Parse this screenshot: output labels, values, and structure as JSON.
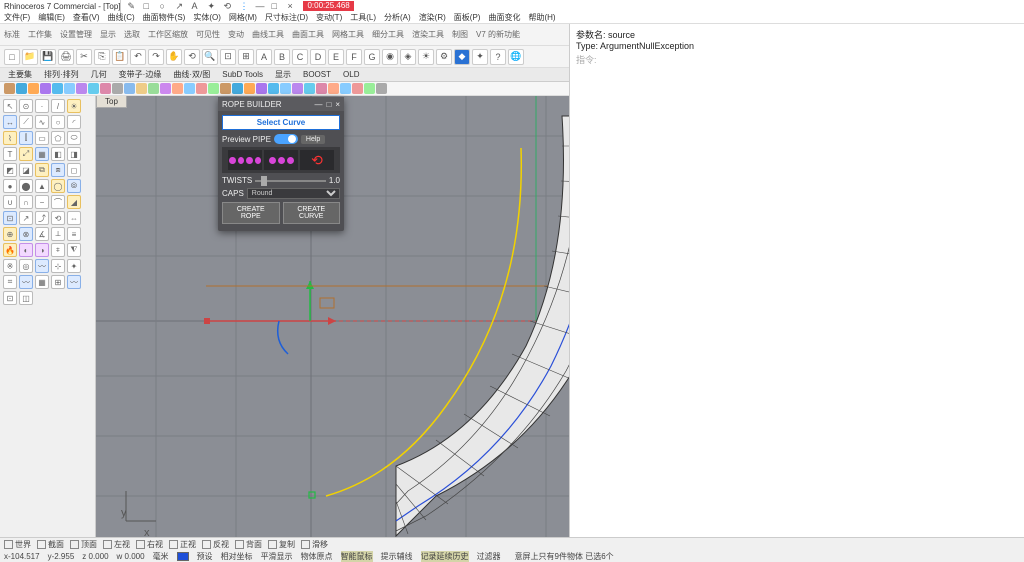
{
  "title": "Rhinoceros 7 Commercial - [Top]",
  "title_badge": "0:00:25.468",
  "menu": [
    "文件(F)",
    "编辑(E)",
    "查看(V)",
    "曲线(C)",
    "曲面物件(S)",
    "实体(O)",
    "网格(M)",
    "尺寸标注(D)",
    "变动(T)",
    "工具(L)",
    "分析(A)",
    "渲染(R)",
    "面板(P)",
    "曲面变化",
    "帮助(H)"
  ],
  "command_panel": {
    "param": "参数名: source",
    "exception": "Type: ArgumentNullException",
    "prompt": "指令:"
  },
  "tabs": [
    "主要集",
    "排列·排列",
    "几何",
    "变带子·边缘",
    "曲线·双/图",
    "SubD Tools",
    "显示",
    "BOOST",
    "OLD"
  ],
  "viewport_tab": "Top",
  "axis_labels": {
    "x": "x",
    "y": "y"
  },
  "panel": {
    "title": "ROPE BUILDER",
    "select_curve": "Select Curve",
    "preview_pipe": "Preview PIPE",
    "help": "Help",
    "twists_label": "TWISTS",
    "twists_value": "1.0",
    "caps_label": "CAPS",
    "caps_value": "Round",
    "create_rope": "CREATE ROPE",
    "create_curve": "CREATE CURVE"
  },
  "status": {
    "row1": [
      "世界",
      "截面",
      "顶面",
      "左视",
      "右视",
      "正视",
      "反视",
      "背面",
      "复制",
      "滑移"
    ],
    "coords": [
      "x-104.517",
      "y-2.955",
      "z 0.000",
      "w 0.000"
    ],
    "info": [
      "毫米",
      "预设"
    ],
    "toggles": [
      "相对坐标",
      "平滑显示",
      "物体原点",
      "智能鼠标",
      "提示辅线",
      "记录延续历史",
      "过滤器"
    ],
    "sel": "意屏上只有9件物体 已选6个"
  }
}
